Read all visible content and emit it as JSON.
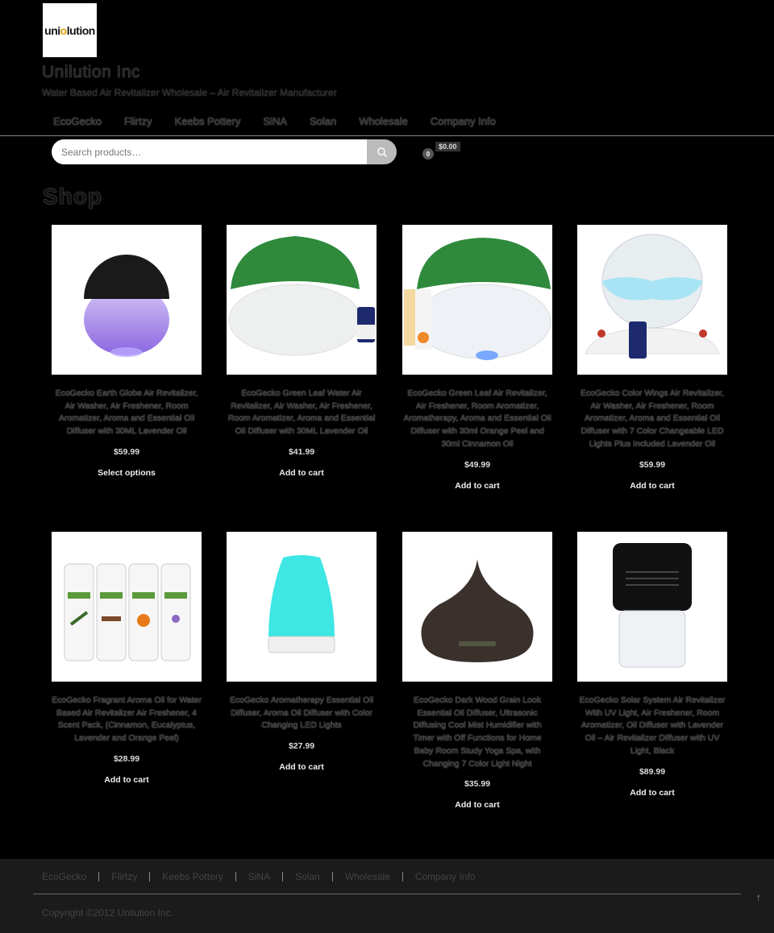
{
  "site": {
    "logo_text_pre": "uni",
    "logo_text_o": "o",
    "logo_text_mid": "lution",
    "title": "Unilution Inc",
    "description": "Water Based Air Revitalizer Wholesale – Air Revitalizer Manufacturer"
  },
  "nav": [
    "EcoGecko",
    "Flirtzy",
    "Keebs Pottery",
    "SiNA",
    "Solan",
    "Wholesale",
    "Company Info"
  ],
  "search": {
    "placeholder": "Search products…"
  },
  "cart": {
    "count": "0",
    "total": "$0.00"
  },
  "page_title": "Shop",
  "products": [
    {
      "name": "EcoGecko Earth Globe Air Revitalizer, Air Washer, Air Freshener, Room Aromatizer, Aroma and Essential Oil Diffuser with 30ML Lavender Oil",
      "price": "$59.99",
      "action": "Select options"
    },
    {
      "name": "EcoGecko Green Leaf Water Air Revitalizer, Air Washer, Air Freshener, Room Aromatizer, Aroma and Essential Oil Diffuser with 30ML Lavender Oil",
      "price": "$41.99",
      "action": "Add to cart"
    },
    {
      "name": "EcoGecko Green Leaf Air Revitalizer, Air Freshener, Room Aromatizer, Aromatherapy, Aroma and Essential Oil Diffuser with 30ml Orange Peel and 30ml Cinnamon Oil",
      "price": "$49.99",
      "action": "Add to cart"
    },
    {
      "name": "EcoGecko Color Wings Air Revitalizer, Air Washer, Air Freshener, Room Aromatizer, Aroma and Essential Oil Diffuser with 7 Color Changeable LED Lights Plus Included Lavender Oil",
      "price": "$59.99",
      "action": "Add to cart"
    },
    {
      "name": "EcoGecko Fragrant Aroma Oil for Water Based Air Revitalizer Air Freshener, 4 Scent Pack, (Cinnamon, Eucalyptus, Lavender and Orange Peel)",
      "price": "$28.99",
      "action": "Add to cart"
    },
    {
      "name": "EcoGecko Aromatherapy Essential Oil Diffuser, Aroma Oil Diffuser with Color Changing LED Lights",
      "price": "$27.99",
      "action": "Add to cart"
    },
    {
      "name": "EcoGecko Dark Wood Grain Look Essential Oil Diffuser, Ultrasonic Diffusing Cool Mist Humidifier with Timer with Off Functions for Home Baby Room Study Yoga Spa, with Changing 7 Color Light Night",
      "price": "$35.99",
      "action": "Add to cart"
    },
    {
      "name": "EcoGecko Solar System Air Revitalizer With UV Light, Air Freshener, Room Aromatizer, Oil Diffuser with Lavender Oil – Air Revitalizer Diffuser with UV Light, Black",
      "price": "$89.99",
      "action": "Add to cart"
    }
  ],
  "footer": {
    "nav": [
      "EcoGecko",
      "Flirtzy",
      "Keebs Pottery",
      "SiNA",
      "Solan",
      "Wholesale",
      "Company Info"
    ],
    "copyright": "Copyright ©2012 Unilution Inc."
  }
}
